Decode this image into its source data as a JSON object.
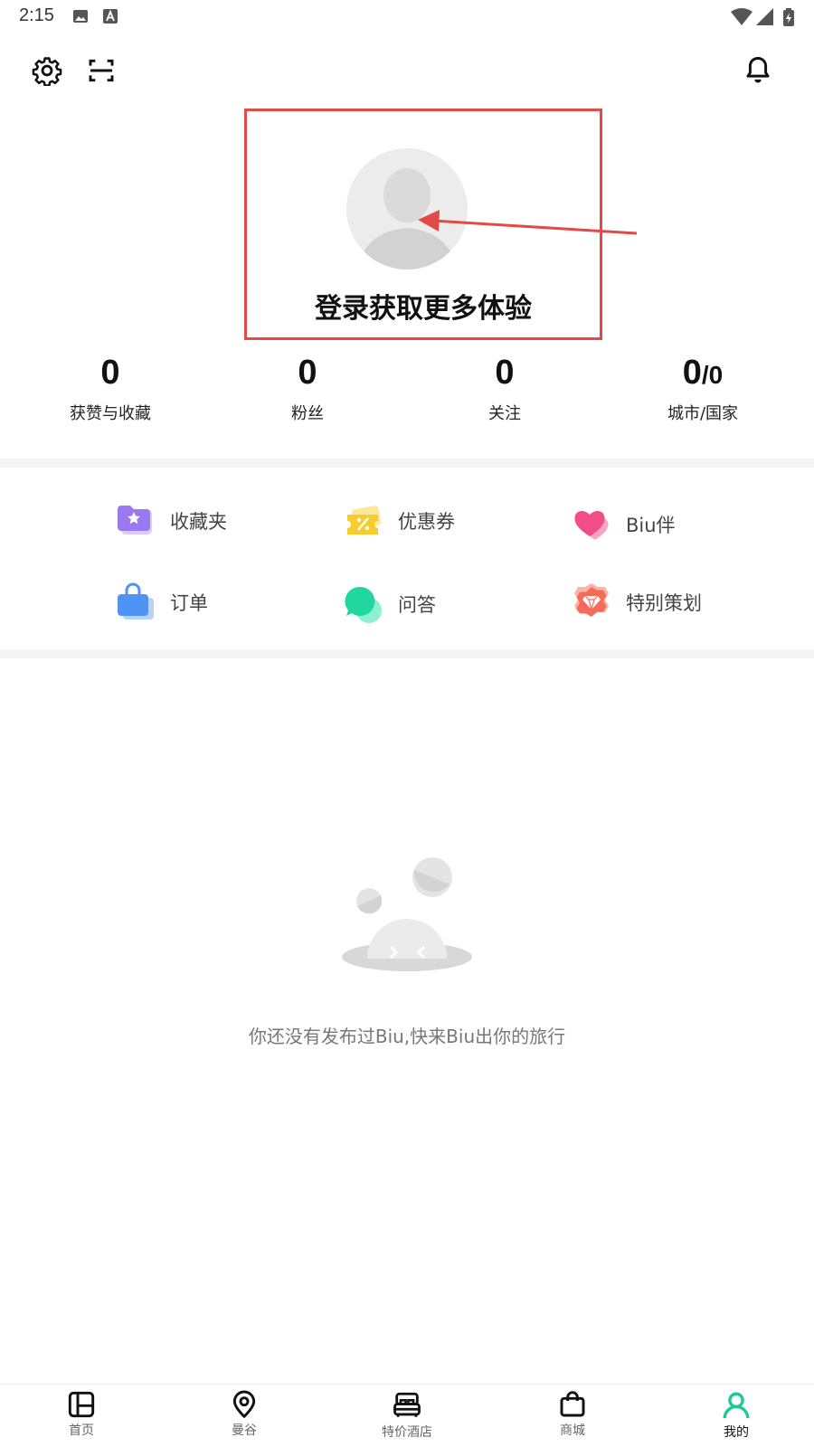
{
  "status_bar": {
    "time": "2:15",
    "icons": [
      "image-icon",
      "a-icon",
      "wifi-icon",
      "signal-icon",
      "battery-icon"
    ]
  },
  "header": {
    "left_icons": [
      "gear-icon",
      "scan-icon"
    ],
    "right_icons": [
      "bell-icon"
    ]
  },
  "login": {
    "text": "登录获取更多体验",
    "highlight_color": "#e24a4a"
  },
  "stats": [
    {
      "value": "0",
      "value_suffix": "",
      "label": "获赞与收藏"
    },
    {
      "value": "0",
      "value_suffix": "",
      "label": "粉丝"
    },
    {
      "value": "0",
      "value_suffix": "",
      "label": "关注"
    },
    {
      "value": "0",
      "value_suffix": "/0",
      "label": "城市/国家"
    }
  ],
  "menu": [
    {
      "label": "收藏夹",
      "icon": "folder-star-icon"
    },
    {
      "label": "优惠券",
      "icon": "coupon-icon"
    },
    {
      "label": "Biu伴",
      "icon": "heart-icon"
    },
    {
      "label": "订单",
      "icon": "bag-icon"
    },
    {
      "label": "问答",
      "icon": "chat-bubble-icon"
    },
    {
      "label": "特别策划",
      "icon": "gem-icon"
    }
  ],
  "empty_state": {
    "text": "你还没有发布过Biu,快来Biu出你的旅行"
  },
  "tabs": [
    {
      "label": "首页",
      "icon": "home-layout-icon",
      "active": false
    },
    {
      "label": "曼谷",
      "icon": "location-pin-icon",
      "active": false
    },
    {
      "label": "特价酒店",
      "icon": "bed-icon",
      "active": false
    },
    {
      "label": "商城",
      "icon": "shopping-bag-icon",
      "active": false
    },
    {
      "label": "我的",
      "icon": "user-icon",
      "active": true
    }
  ],
  "colors": {
    "accent": "#1ec997",
    "highlight": "#e24a4a"
  }
}
